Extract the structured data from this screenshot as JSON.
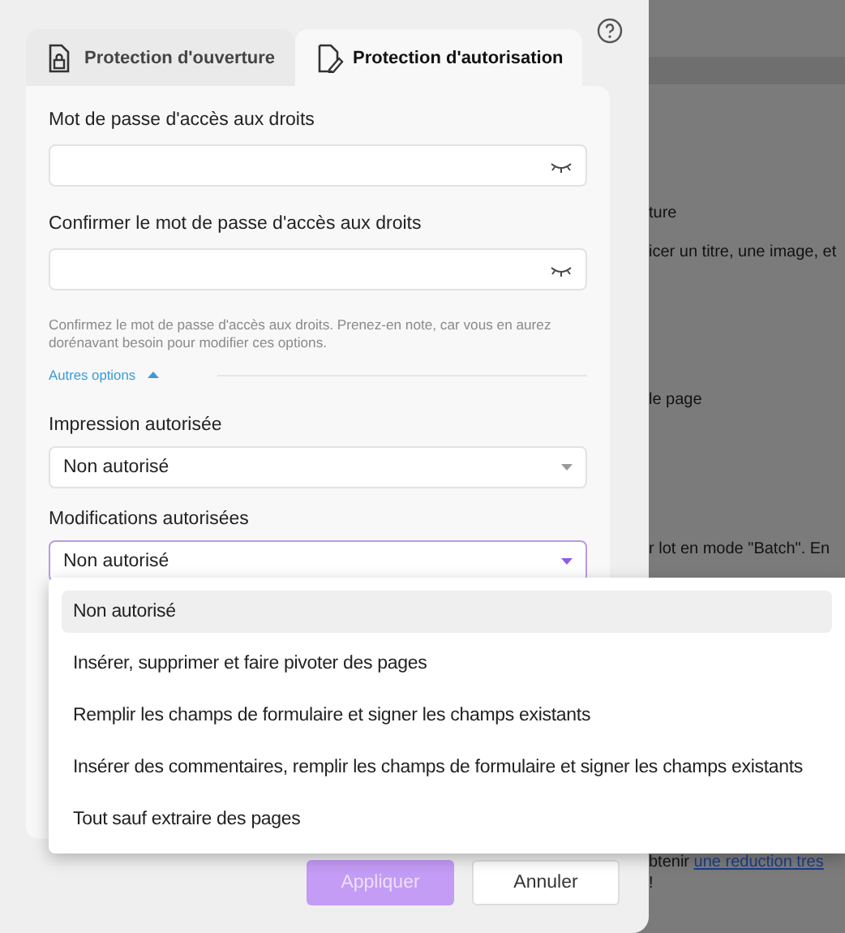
{
  "tabs": [
    {
      "label": "Protection d'ouverture",
      "kind": "lock",
      "selected": false
    },
    {
      "label": "Protection d'autorisation",
      "kind": "edit",
      "selected": true
    }
  ],
  "password_fields": [
    {
      "label": "Mot de passe d'accès aux droits"
    },
    {
      "label": "Confirmer le mot de passe d'accès aux droits"
    }
  ],
  "hint": "Confirmez le mot de passe d'accès aux droits. Prenez-en note, car vous en aurez dorénavant besoin pour modifier ces options.",
  "more_options": {
    "label": "Autres options",
    "expanded": true
  },
  "selects": [
    {
      "label": "Impression autorisée",
      "value": "Non autorisé",
      "open": false
    },
    {
      "label": "Modifications autorisées",
      "value": "Non autorisé",
      "open": true
    }
  ],
  "menu": [
    {
      "label": "Non autorisé",
      "selected": true
    },
    {
      "label": "Insérer, supprimer et faire pivoter des pages",
      "selected": false
    },
    {
      "label": "Remplir les champs de formulaire et signer les champs existants",
      "selected": false
    },
    {
      "label": "Insérer des commentaires, remplir les champs de formulaire et signer les champs existants",
      "selected": false
    },
    {
      "label": "Tout sauf extraire des pages",
      "selected": false
    }
  ],
  "buttons": [
    {
      "label": "Appliquer",
      "kind": "primary",
      "disabled": true
    },
    {
      "label": "Annuler",
      "kind": "secondary",
      "disabled": false
    }
  ],
  "background_lines": [
    {
      "text": "ture"
    },
    {
      "text": "icer un titre, une image, et"
    },
    {
      "text": "le page"
    },
    {
      "text": "r lot en mode \"Batch\". En"
    },
    {
      "text": "btenir ",
      "link": "une reduction tres"
    },
    {
      "text": "!"
    }
  ]
}
